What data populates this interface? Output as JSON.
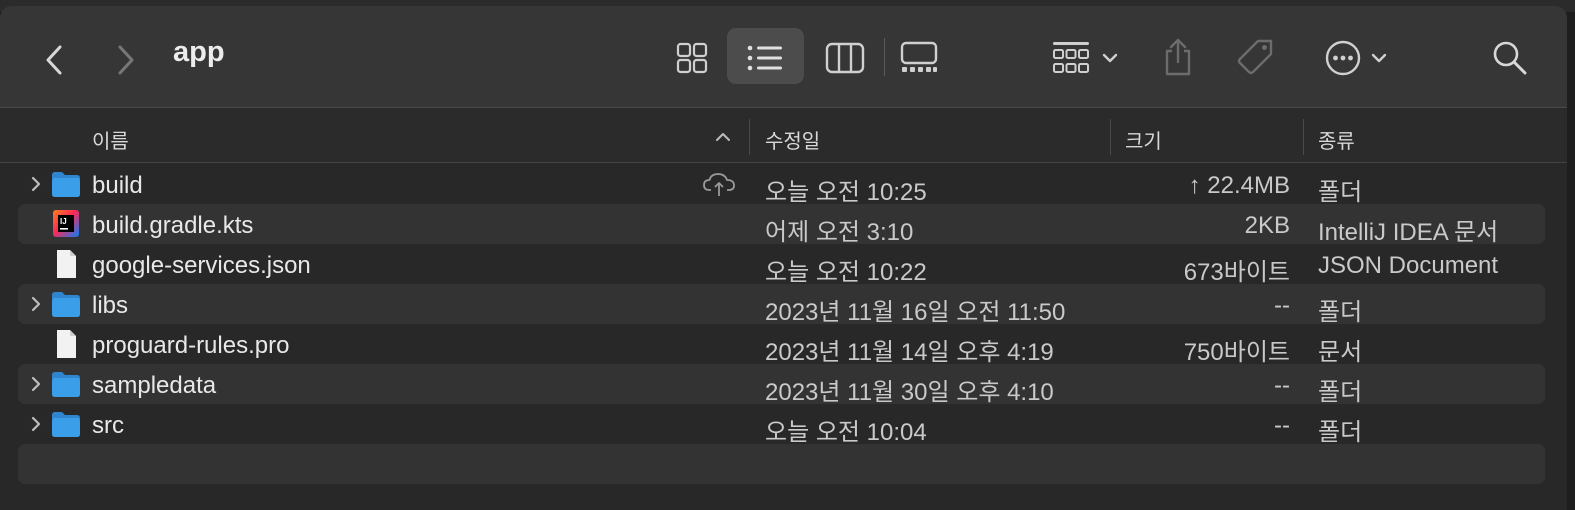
{
  "window": {
    "title": "app",
    "toolbar": {
      "back_icon": "chevron-left-icon",
      "forward_icon": "chevron-right-icon",
      "views": [
        "icon-view",
        "list-view",
        "column-view",
        "gallery-view"
      ],
      "active_view": "list-view",
      "group_icon": "group-grid-icon",
      "share_icon": "share-icon",
      "tag_icon": "tag-icon",
      "more_icon": "ellipsis-circle-icon",
      "search_icon": "search-icon"
    }
  },
  "columns": {
    "name": "이름",
    "modified": "수정일",
    "size": "크기",
    "kind": "종류",
    "sort_indicator": "chevron-up-icon"
  },
  "files": [
    {
      "name": "build",
      "type": "folder",
      "expandable": true,
      "cloud": true,
      "modified": "오늘 오전 10:25",
      "size": "↑ 22.4MB",
      "kind": "폴더"
    },
    {
      "name": "build.gradle.kts",
      "type": "intellij",
      "expandable": false,
      "cloud": false,
      "modified": "어제 오전 3:10",
      "size": "2KB",
      "kind": "IntelliJ IDEA 문서"
    },
    {
      "name": "google-services.json",
      "type": "document",
      "expandable": false,
      "cloud": false,
      "modified": "오늘 오전 10:22",
      "size": "673바이트",
      "kind": "JSON Document"
    },
    {
      "name": "libs",
      "type": "folder",
      "expandable": true,
      "cloud": false,
      "modified": "2023년 11월 16일 오전 11:50",
      "size": "--",
      "kind": "폴더"
    },
    {
      "name": "proguard-rules.pro",
      "type": "document",
      "expandable": false,
      "cloud": false,
      "modified": "2023년 11월 14일 오후 4:19",
      "size": "750바이트",
      "kind": "문서"
    },
    {
      "name": "sampledata",
      "type": "folder",
      "expandable": true,
      "cloud": false,
      "modified": "2023년 11월 30일 오후 4:10",
      "size": "--",
      "kind": "폴더"
    },
    {
      "name": "src",
      "type": "folder",
      "expandable": true,
      "cloud": false,
      "modified": "오늘 오전 10:04",
      "size": "--",
      "kind": "폴더"
    }
  ],
  "colors": {
    "folder": "#3a9ee8",
    "folder_tab": "#2f86cf",
    "toolbar_bg": "#363636",
    "row_alt": "#333333"
  }
}
